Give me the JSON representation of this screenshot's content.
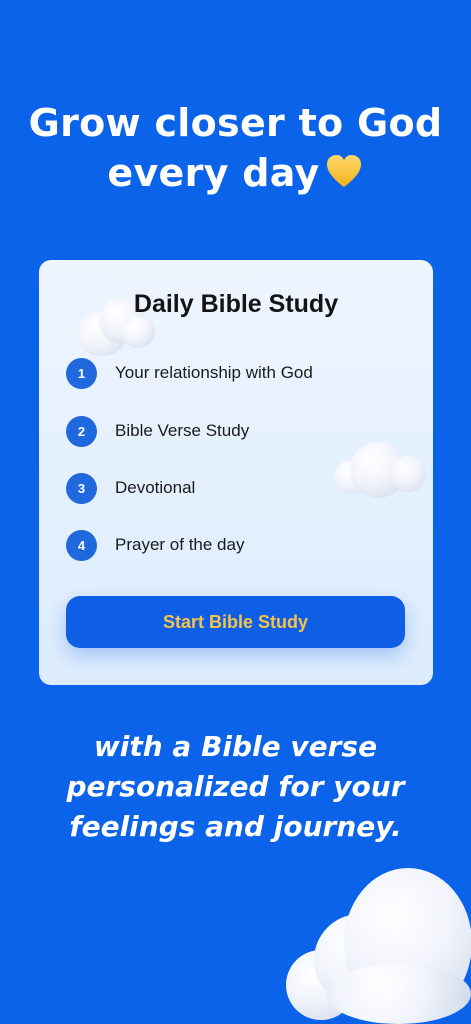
{
  "headline": {
    "line1": "Grow closer to God",
    "line2": "every day",
    "emoji_icon": "yellow-heart-icon"
  },
  "card": {
    "title": "Daily Bible Study",
    "steps": [
      {
        "number": "1",
        "label": "Your relationship with God"
      },
      {
        "number": "2",
        "label": "Bible Verse Study"
      },
      {
        "number": "3",
        "label": "Devotional"
      },
      {
        "number": "4",
        "label": "Prayer of the day"
      }
    ],
    "button_label": "Start Bible Study"
  },
  "tagline": {
    "line1": "with a Bible verse",
    "line2": "personalized for your",
    "line3": "feelings and journey."
  },
  "colors": {
    "background": "#0b63ea",
    "button": "#0f5fe6",
    "button_text": "#f6c34a",
    "step_circle": "#1f68dd"
  }
}
